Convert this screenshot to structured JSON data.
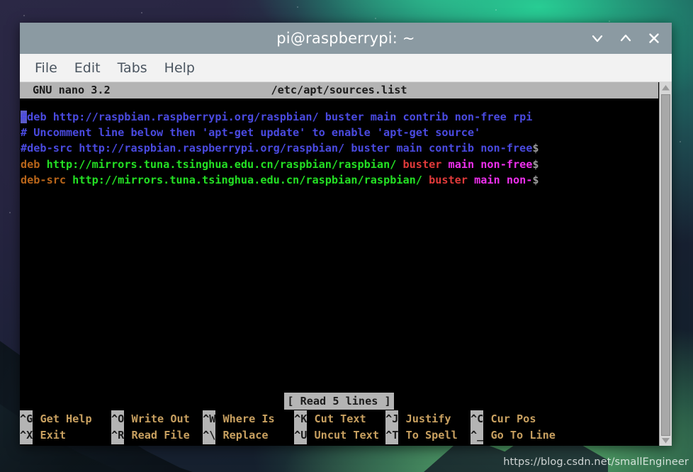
{
  "window": {
    "title": "pi@raspberrypi: ~",
    "controls": {
      "minimize": "minimize",
      "maximize": "maximize",
      "close": "close"
    }
  },
  "menubar": {
    "items": [
      {
        "label": "File"
      },
      {
        "label": "Edit"
      },
      {
        "label": "Tabs"
      },
      {
        "label": "Help"
      }
    ]
  },
  "nano": {
    "version": "GNU nano 3.2",
    "filename": "/etc/apt/sources.list",
    "status": "[ Read 5 lines ]",
    "lines": [
      {
        "segments": [
          {
            "text": "#",
            "style": "cursor"
          },
          {
            "text": "deb http://raspbian.raspberrypi.org/raspbian/ buster main contrib non-free rpi",
            "style": "comment"
          }
        ]
      },
      {
        "segments": [
          {
            "text": "# Uncomment line below then 'apt-get update' to enable 'apt-get source'",
            "style": "comment"
          }
        ]
      },
      {
        "segments": [
          {
            "text": "#deb-src http://raspbian.raspberrypi.org/raspbian/ buster main contrib non-free",
            "style": "comment"
          },
          {
            "text": "$",
            "style": "continuation"
          }
        ]
      },
      {
        "segments": [
          {
            "text": "deb",
            "style": "deb"
          },
          {
            "text": " ",
            "style": "plain"
          },
          {
            "text": "http://mirrors.tuna.tsinghua.edu.cn/raspbian/raspbian/",
            "style": "url"
          },
          {
            "text": " ",
            "style": "plain"
          },
          {
            "text": "buster",
            "style": "dist"
          },
          {
            "text": " ",
            "style": "plain"
          },
          {
            "text": "main non-free",
            "style": "component"
          },
          {
            "text": "$",
            "style": "continuation"
          }
        ]
      },
      {
        "segments": [
          {
            "text": "deb-src",
            "style": "deb"
          },
          {
            "text": " ",
            "style": "plain"
          },
          {
            "text": "http://mirrors.tuna.tsinghua.edu.cn/raspbian/raspbian/",
            "style": "url"
          },
          {
            "text": " ",
            "style": "plain"
          },
          {
            "text": "buster",
            "style": "dist"
          },
          {
            "text": " ",
            "style": "plain"
          },
          {
            "text": "main non-",
            "style": "component"
          },
          {
            "text": "$",
            "style": "continuation"
          }
        ]
      }
    ],
    "shortcuts": {
      "row1": [
        {
          "key": "^G",
          "label": "Get Help"
        },
        {
          "key": "^O",
          "label": "Write Out"
        },
        {
          "key": "^W",
          "label": "Where Is"
        },
        {
          "key": "^K",
          "label": "Cut Text"
        },
        {
          "key": "^J",
          "label": "Justify"
        },
        {
          "key": "^C",
          "label": "Cur Pos"
        }
      ],
      "row2": [
        {
          "key": "^X",
          "label": "Exit"
        },
        {
          "key": "^R",
          "label": "Read File"
        },
        {
          "key": "^\\",
          "label": "Replace"
        },
        {
          "key": "^U",
          "label": "Uncut Text"
        },
        {
          "key": "^T",
          "label": "To Spell"
        },
        {
          "key": "^_",
          "label": "Go To Line"
        }
      ]
    }
  },
  "watermark": {
    "text": "https://blog.csdn.net/smallEngineer"
  },
  "colors": {
    "titlebar": "#8b9aa2",
    "menubar": "#f2f2f2",
    "terminal_bg": "#000000",
    "nano_bar": "#b4b4b4",
    "comment": "#4a4ae0",
    "deb_keyword": "#b8651a",
    "url": "#24e024",
    "distribution": "#e03a3a",
    "component": "#ee30ee",
    "shortcut_label": "#c8a060"
  }
}
